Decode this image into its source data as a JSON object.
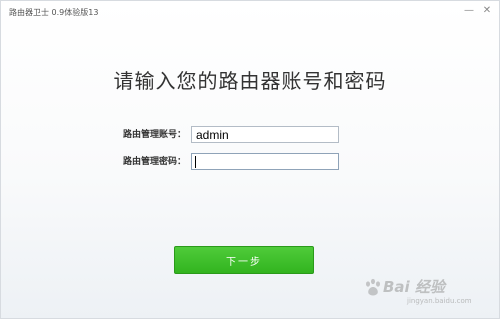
{
  "window": {
    "title": "路由器卫士 0.9体验版13",
    "controls": [
      "—",
      "✕"
    ]
  },
  "main": {
    "heading": "请输入您的路由器账号和密码",
    "account": {
      "label": "路由管理账号：",
      "value": "admin"
    },
    "password": {
      "label": "路由管理密码：",
      "value": ""
    },
    "next_button": "下一步"
  },
  "watermark": {
    "brand": "Bai 经验",
    "url": "jingyan.baidu.com"
  },
  "colors": {
    "accent_green": "#3cbf28",
    "text": "#333333",
    "input_border": "#b3bcc6"
  },
  "icons": [
    "minimize-icon",
    "close-icon",
    "baidu-paw-icon"
  ]
}
